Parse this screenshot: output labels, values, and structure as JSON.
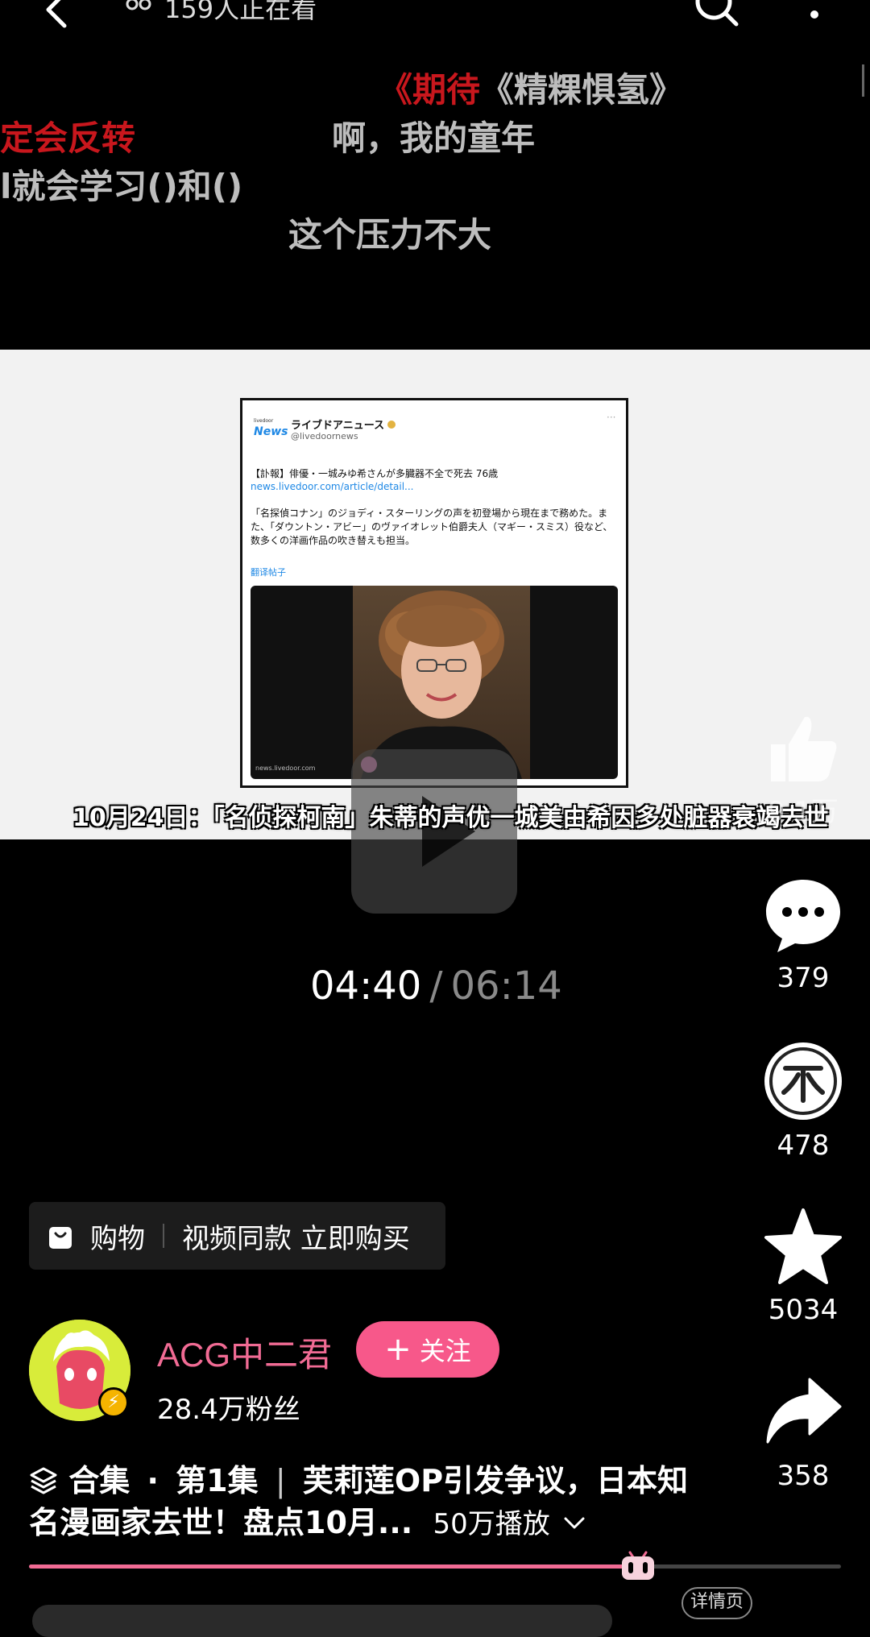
{
  "header": {
    "viewers_text": "159人正在看"
  },
  "danmaku": {
    "d1_red": "《期待",
    "d1_grey": "《精粿惧氢》",
    "d2": "定会反转",
    "d3": "啊，我的童年",
    "d4": "l就会学习()和()",
    "d5": "这个压力不大"
  },
  "video": {
    "tweet": {
      "logo_top": "livedoor",
      "logo_main": "News",
      "account_name": "ライブドアニュース",
      "handle": "@livedoornews",
      "headline": "【訃報】俳優・一城みゆ希さんが多臓器不全で死去 76歳",
      "link": "news.livedoor.com/article/detail...",
      "body": "「名探偵コナン」のジョディ・スターリングの声を初登場から現在まで務めた。また、「ダウントン・アビー」のヴァイオレット伯爵夫人（マギー・スミス）役など、数多くの洋画作品の吹き替えも担当。",
      "translate": "翻译帖子",
      "photo_credit": "news.livedoor.com"
    },
    "subtitle": "10月24日：「名侦探柯南」朱蒂的声优一城美由希因多处脏器衰竭去世",
    "time_current": "04:40",
    "time_separator": "/",
    "time_total": "06:14",
    "progress": 0.755
  },
  "actions": {
    "likes": "9.1万",
    "comments": "379",
    "coins": "478",
    "favorites": "5034",
    "shares": "358"
  },
  "shopping": {
    "label": "购物",
    "promo": "视频同款 立即购买"
  },
  "author": {
    "name": "ACG中二君",
    "follow_label": "关注",
    "fans": "28.4万粉丝"
  },
  "title": {
    "collection": "合集",
    "dot": "·",
    "episode": "第1集",
    "bar": "|",
    "text": "芙莉莲OP引发争议，日本知名漫画家去世！盘点10月...",
    "views": "50万播放"
  },
  "bottom": {
    "detail_label": "详情页"
  },
  "colors": {
    "accent_pink": "#f16b94",
    "follow_pink": "#f7588a",
    "danmaku_red": "#c8171d"
  }
}
